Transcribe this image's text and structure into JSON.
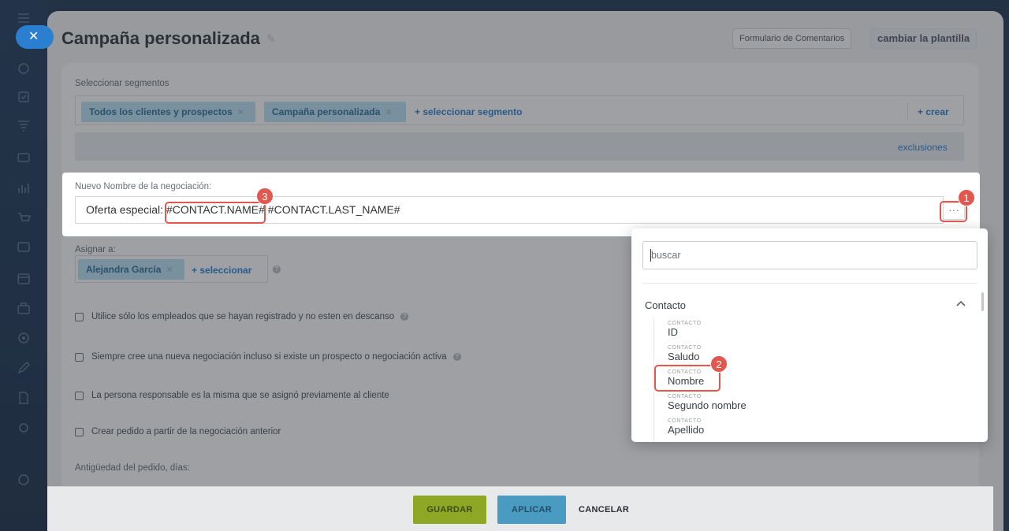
{
  "panel": {
    "title": "Campaña personalizada",
    "feedback_button": "Formulario de Comentarios",
    "template_button": "cambiar la plantilla"
  },
  "segments": {
    "label": "Seleccionar segmentos",
    "tags": [
      "Todos los clientes y prospectos",
      "Campaña personalizada"
    ],
    "select_link": "+ seleccionar segmento",
    "create_link": "+ crear",
    "exclusions_link": "exclusiones"
  },
  "deal_name": {
    "label": "Nuevo Nombre de la negociación:",
    "value": "Oferta especial: #CONTACT.NAME# #CONTACT.LAST_NAME#",
    "menu_button": "···"
  },
  "assign": {
    "label": "Asignar a:",
    "tag": "Alejandra García",
    "select_link": "+ seleccionar"
  },
  "options": [
    "Utilice sólo los empleados que se hayan registrado y no esten en descanso",
    "Siempre cree una nueva negociación incluso si existe un prospecto o negociación activa",
    "La persona responsable es la misma que se asignó previamente al cliente",
    "Crear pedido a partir de la negociación anterior"
  ],
  "order_age": {
    "label": "Antigüedad del pedido, días:"
  },
  "popup": {
    "search_placeholder": "buscar",
    "group": "Contacto",
    "fields": [
      {
        "category": "CONTACTO",
        "name": "ID"
      },
      {
        "category": "CONTACTO",
        "name": "Saludo"
      },
      {
        "category": "CONTACTO",
        "name": "Nombre"
      },
      {
        "category": "CONTACTO",
        "name": "Segundo nombre"
      },
      {
        "category": "CONTACTO",
        "name": "Apellido"
      }
    ]
  },
  "badges": [
    "1",
    "2",
    "3"
  ],
  "footer": {
    "save": "GUARDAR",
    "apply": "APLICAR",
    "cancel": "CANCELAR"
  },
  "colors": {
    "accent": "#2b7fd0",
    "highlight": "#e2584e",
    "save": "#8ea826",
    "apply": "#4a9bc2"
  }
}
